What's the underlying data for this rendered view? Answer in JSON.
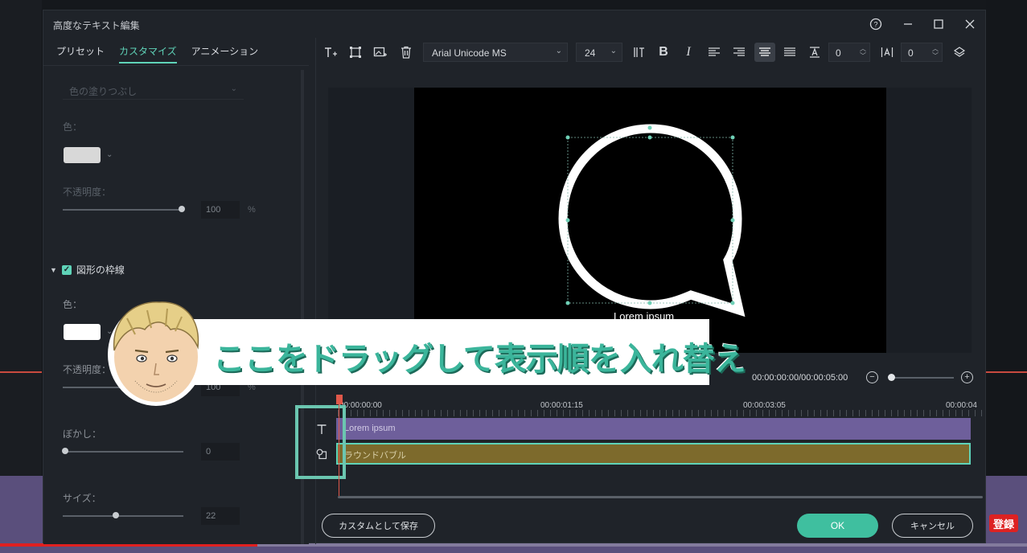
{
  "window": {
    "title": "高度なテキスト編集",
    "help_icon": "?",
    "minimize_icon": "—",
    "maximize_icon": "☐",
    "close_icon": "✕"
  },
  "tabs": [
    {
      "label": "プリセット",
      "active": false
    },
    {
      "label": "カスタマイズ",
      "active": true
    },
    {
      "label": "アニメーション",
      "active": false
    }
  ],
  "left_panel": {
    "fill_dropdown": "色の塗りつぶし",
    "fill": {
      "color_label": "色：",
      "color_value": "#d8d8d8",
      "opacity_label": "不透明度：",
      "opacity_value": "100",
      "opacity_unit": "%"
    },
    "outline_section": {
      "title": "図形の枠線",
      "checked": true,
      "color_label": "色：",
      "color_value": "#ffffff",
      "opacity_label": "不透明度：",
      "opacity_value": "100",
      "opacity_unit": "%",
      "blur_label": "ぼかし：",
      "blur_value": "0",
      "size_label": "サイズ：",
      "size_value": "22"
    }
  },
  "toolbar": {
    "font": "Arial Unicode MS",
    "font_size": "24",
    "char_spacing": "0",
    "line_spacing": "0",
    "alignment": "center"
  },
  "preview": {
    "caption": "Lorem ipsum"
  },
  "playback": {
    "timecode": "00:00:00:00/00:00:05:00",
    "zoom_level": 0.05
  },
  "timeline": {
    "ruler_labels": [
      "00:00:00:00",
      "00:00:01:15",
      "00:00:03:05",
      "00:00:04"
    ],
    "tracks": [
      {
        "label": "Lorem ipsum",
        "icon": "text-icon"
      },
      {
        "label": "ラウンドバブル",
        "icon": "shape-icon"
      }
    ]
  },
  "buttons": {
    "save_custom": "カスタムとして保存",
    "ok": "OK",
    "cancel": "キャンセル"
  },
  "overlay": {
    "caption": "ここをドラッグして表示順を入れ替え"
  },
  "channel": {
    "subscribe_label": "登録"
  },
  "colors": {
    "accent": "#5fd3b8",
    "ok_button": "#3fbf9f",
    "text_track": "#6e5f9b",
    "shape_track": "#7d6a2c",
    "playhead": "#e0584a"
  }
}
